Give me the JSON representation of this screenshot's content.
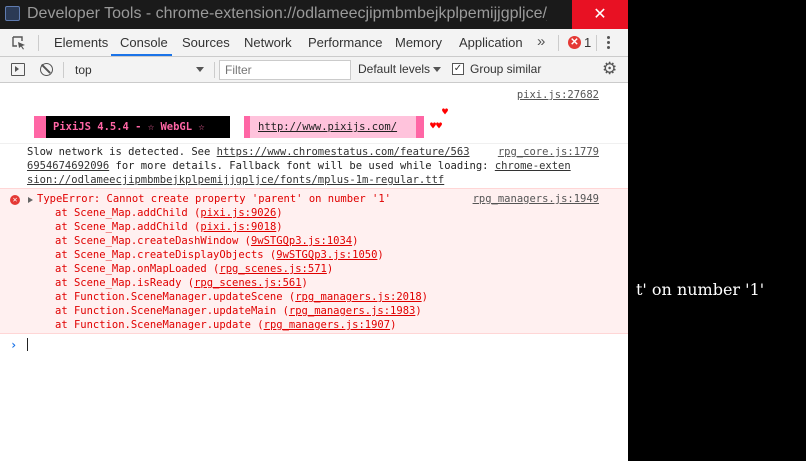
{
  "window": {
    "title": "Developer Tools - chrome-extension://odlameecjipmbmbejkplpemijjgpljce/_generated_background_page.html",
    "close_glyph": "✕"
  },
  "tabs": {
    "items": [
      "Elements",
      "Console",
      "Sources",
      "Network",
      "Performance",
      "Memory",
      "Application"
    ],
    "active": "Console",
    "more": "»",
    "error_count": "1",
    "error_glyph": "✕"
  },
  "toolbar": {
    "context": "top",
    "filter_placeholder": "Filter",
    "levels": "Default levels",
    "group_similar": "Group similar",
    "group_similar_checked": true,
    "check_glyph": "✓",
    "gear_glyph": "⚙"
  },
  "console": {
    "pixi_source": "pixi.js:27682",
    "pixi_banner": "PixiJS 4.5.4 - ☆ WebGL ☆",
    "pixi_url": "http://www.pixijs.com/",
    "hearts_top": "♥",
    "hearts_bottom": "♥♥",
    "slow": {
      "text1": "Slow network is detected. See ",
      "link1": "https://www.chromestatus.com/feature/563",
      "text2": "6954674692096",
      "text3": " for more details. Fallback font will be used while loading: ",
      "link2a": "chrome-exten",
      "link2b": "sion://odlameecjipmbmbejkplpemijjgpljce/fonts/mplus-1m-regular.ttf",
      "source": "rpg_core.js:1779"
    },
    "error": {
      "message": "TypeError: Cannot create property 'parent' on number '1'",
      "source": "rpg_managers.js:1949",
      "stack": [
        {
          "fn": "at Scene_Map.addChild (",
          "loc": "pixi.js:9026"
        },
        {
          "fn": "at Scene_Map.addChild (",
          "loc": "pixi.js:9018"
        },
        {
          "fn": "at Scene_Map.createDashWindow (",
          "loc": "9wSTGQp3.js:1034"
        },
        {
          "fn": "at Scene_Map.createDisplayObjects (",
          "loc": "9wSTGQp3.js:1050"
        },
        {
          "fn": "at Scene_Map.onMapLoaded (",
          "loc": "rpg_scenes.js:571"
        },
        {
          "fn": "at Scene_Map.isReady (",
          "loc": "rpg_scenes.js:561"
        },
        {
          "fn": "at Function.SceneManager.updateScene (",
          "loc": "rpg_managers.js:2018"
        },
        {
          "fn": "at Function.SceneManager.updateMain (",
          "loc": "rpg_managers.js:1983"
        },
        {
          "fn": "at Function.SceneManager.update (",
          "loc": "rpg_managers.js:1907"
        }
      ],
      "close_paren": ")"
    },
    "prompt": "›"
  },
  "side_text": "t' on number '1'",
  "colors": {
    "accent": "#1a73e8",
    "error": "#e00000",
    "pixi_pink": "#ff66a5",
    "close_red": "#e81123"
  }
}
